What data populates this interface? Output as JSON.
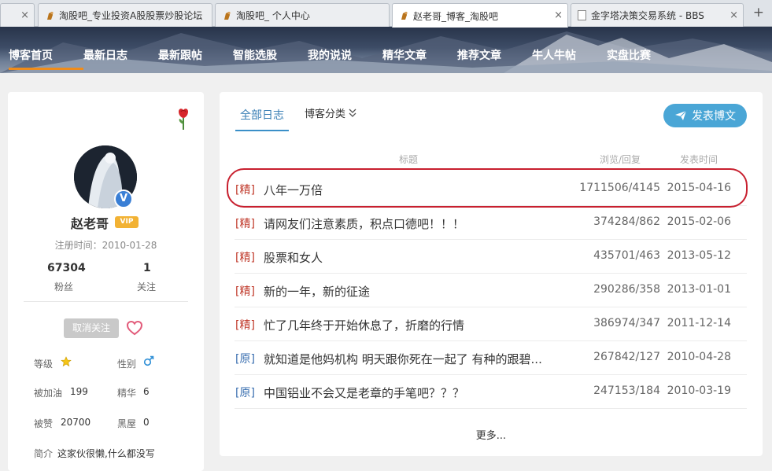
{
  "browser": {
    "tabs": [
      {
        "title": "淘股吧_专业投资A股股票炒股论坛",
        "active": false
      },
      {
        "title": "淘股吧_ 个人中心",
        "active": false
      },
      {
        "title": "赵老哥_博客_淘股吧",
        "active": true
      },
      {
        "title": "金字塔决策交易系统 - BBS",
        "active": false
      }
    ],
    "new_tab": "+",
    "close": "×"
  },
  "nav": {
    "items": [
      "博客首页",
      "最新日志",
      "最新跟帖",
      "智能选股",
      "我的说说",
      "精华文章",
      "推荐文章",
      "牛人牛帖",
      "实盘比赛"
    ]
  },
  "profile": {
    "username": "赵老哥",
    "vip": "VIP",
    "verified": "V",
    "register_date": "注册时间：2010-01-28",
    "fans_count": "67304",
    "fans_label": "粉丝",
    "follow_count": "1",
    "follow_label": "关注",
    "unfollow_label": "取消关注",
    "level_label": "等级",
    "gender_label": "性别",
    "cheer_label": "被加油",
    "cheer_value": "199",
    "essence_label": "精华",
    "essence_value": "6",
    "liked_label": "被赞",
    "liked_value": "20700",
    "blackroom_label": "黑屋",
    "blackroom_value": "0",
    "bio_label": "简介",
    "bio_value": "这家伙很懒,什么都没写"
  },
  "blog": {
    "tab_all": "全部日志",
    "tab_category": "博客分类",
    "post_button": "发表博文",
    "headers": {
      "title": "标题",
      "views": "浏览/回复",
      "date": "发表时间"
    },
    "posts": [
      {
        "tag": "[精]",
        "title": "八年一万倍",
        "views": "1711506/4145",
        "date": "2015-04-16"
      },
      {
        "tag": "[精]",
        "title": "请网友们注意素质，积点口德吧！！！",
        "views": "374284/862",
        "date": "2015-02-06"
      },
      {
        "tag": "[精]",
        "title": "股票和女人",
        "views": "435701/463",
        "date": "2013-05-12"
      },
      {
        "tag": "[精]",
        "title": "新的一年，新的征途",
        "views": "290286/358",
        "date": "2013-01-01"
      },
      {
        "tag": "[精]",
        "title": "忙了几年终于开始休息了，折磨的行情",
        "views": "386974/347",
        "date": "2011-12-14"
      },
      {
        "tag": "[原]",
        "title": "就知道是他妈机构   明天跟你死在一起了  有种的跟碧...",
        "views": "267842/127",
        "date": "2010-04-28"
      },
      {
        "tag": "[原]",
        "title": "中国铝业不会又是老章的手笔吧？？？",
        "views": "247153/184",
        "date": "2010-03-19"
      }
    ],
    "more": "更多..."
  }
}
